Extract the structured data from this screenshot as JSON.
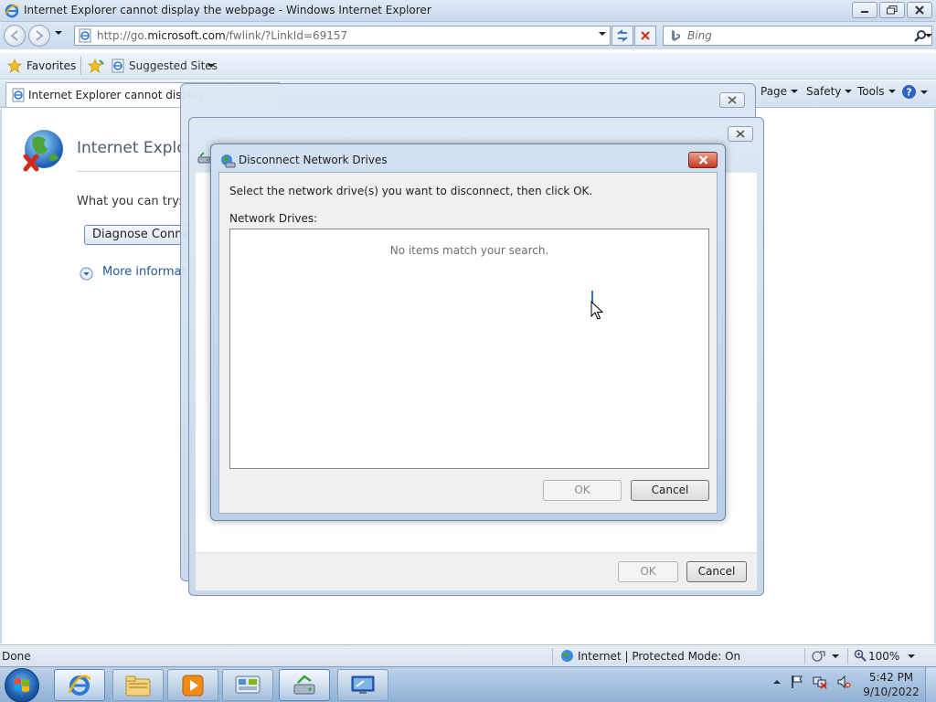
{
  "window": {
    "title": "Internet Explorer cannot display the webpage - Windows Internet Explorer"
  },
  "navbar": {
    "url_prefix": "http://go.",
    "url_domain": "microsoft.com",
    "url_suffix": "/fwlink/?LinkId=69157",
    "search_placeholder": "Bing"
  },
  "favbar": {
    "favorites_label": "Favorites",
    "suggested_label": "Suggested Sites"
  },
  "tabbar": {
    "tab_label": "Internet Explorer cannot display",
    "commands": [
      "Page",
      "Safety",
      "Tools"
    ]
  },
  "page": {
    "title": "Internet Explor",
    "what_you_can_try": "What you can try:",
    "diagnose_label": "Diagnose Connec",
    "more_info": "More informat"
  },
  "status": {
    "text": "Done",
    "zone": "Internet | Protected Mode: On",
    "zoom": "100%"
  },
  "dialog": {
    "title": "Disconnect Network Drives",
    "instruction": "Select the network drive(s) you want to disconnect, then click OK.",
    "list_label": "Network Drives:",
    "empty_text": "No items match your search.",
    "ok_label": "OK",
    "cancel_label": "Cancel"
  },
  "bg_dialog": {
    "ok_label": "OK",
    "cancel_label": "Cancel"
  },
  "taskbar": {
    "time": "5:42 PM",
    "date": "9/10/2022"
  },
  "colors": {
    "accent": "#1f5aa0",
    "close_red": "#c5391e"
  }
}
